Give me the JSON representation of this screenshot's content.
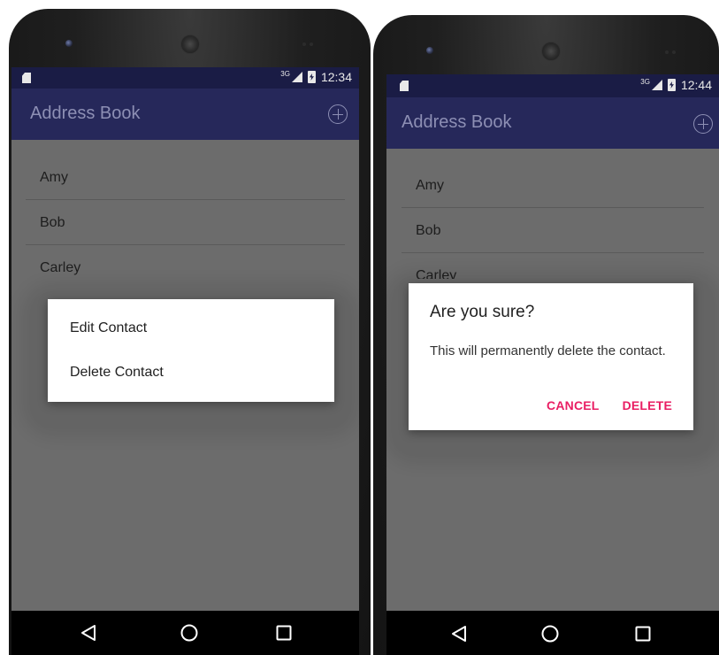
{
  "colors": {
    "status_bar": "#1a1c45",
    "app_bar": "#26285a",
    "dim_background": "#6c6c6c",
    "accent": "#e91e63"
  },
  "left_screen": {
    "status_bar": {
      "network": "3G",
      "time": "12:34"
    },
    "app_bar": {
      "title": "Address Book",
      "add_icon": "add-circle-icon"
    },
    "contacts": [
      "Amy",
      "Bob",
      "Carley"
    ],
    "context_menu": {
      "items": [
        "Edit Contact",
        "Delete Contact"
      ]
    },
    "nav_bar": {
      "back_icon": "back-icon",
      "home_icon": "home-icon",
      "recents_icon": "recents-icon"
    }
  },
  "right_screen": {
    "status_bar": {
      "network": "3G",
      "time": "12:44"
    },
    "app_bar": {
      "title": "Address Book",
      "add_icon": "add-circle-icon"
    },
    "contacts": [
      "Amy",
      "Bob",
      "Carley"
    ],
    "dialog": {
      "title": "Are you sure?",
      "message": "This will permanently delete the contact.",
      "cancel_label": "CANCEL",
      "delete_label": "DELETE"
    },
    "nav_bar": {
      "back_icon": "back-icon",
      "home_icon": "home-icon",
      "recents_icon": "recents-icon"
    }
  }
}
